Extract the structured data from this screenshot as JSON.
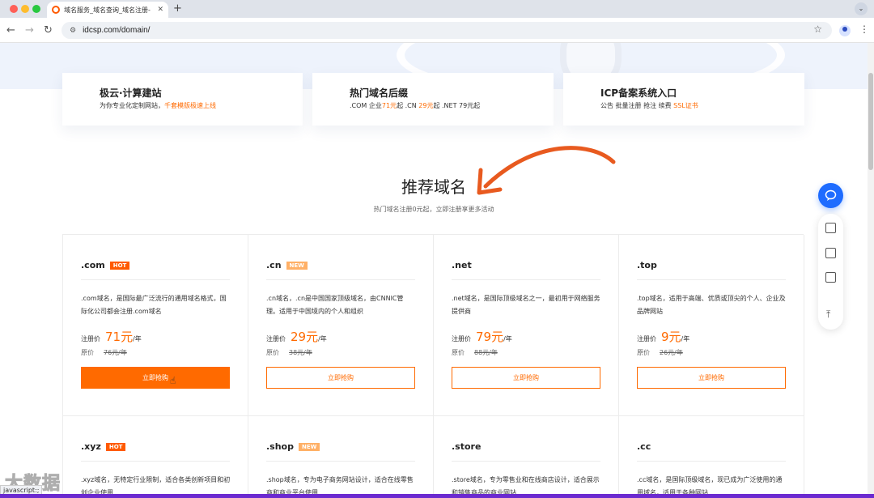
{
  "browser": {
    "tab_title": "域名服务_域名查询_域名注册-",
    "tab_close": "✕",
    "new_tab": "+",
    "url": "idcsp.com/domain/",
    "status_url": "javascript:;"
  },
  "quick_cards": [
    {
      "title": "极云·计算建站",
      "desc_prefix": "为你专业化定制网站，",
      "desc_highlight": "千套模版极速上线",
      "desc_mid": "",
      "desc_highlight2": "",
      "desc_suffix": ""
    },
    {
      "title": "热门域名后缀",
      "desc_prefix": ".COM 企业",
      "desc_highlight": "71元",
      "desc_mid": "起 .CN ",
      "desc_highlight2": "29元",
      "desc_suffix": "起 .NET 79元起"
    },
    {
      "title": "ICP备案系统入口",
      "desc_prefix": "公告 批量注册 抢注 续费 ",
      "desc_highlight": "SSL证书",
      "desc_mid": "",
      "desc_highlight2": "",
      "desc_suffix": ""
    }
  ],
  "section": {
    "title": "推荐域名",
    "subtitle": "热门域名注册0元起，立即注册享更多活动"
  },
  "domains": [
    {
      "name": ".com",
      "badge": "HOT",
      "desc": ".com域名，是国际最广泛流行的通用域名格式，国际化公司都会注册.com域名",
      "price_label": "注册价",
      "price": "71元",
      "unit": "/年",
      "orig_label": "原价",
      "orig": "76元/年",
      "button": "立即抢购"
    },
    {
      "name": ".cn",
      "badge": "NEW",
      "desc": ".cn域名，.cn是中国国家顶级域名，由CNNIC管理。适用于中国境内的个人和组织",
      "price_label": "注册价",
      "price": "29元",
      "unit": "/年",
      "orig_label": "原价",
      "orig": "38元/年",
      "button": "立即抢购"
    },
    {
      "name": ".net",
      "badge": "",
      "desc": ".net域名，是国际顶级域名之一，最初用于网络服务提供商",
      "price_label": "注册价",
      "price": "79元",
      "unit": "/年",
      "orig_label": "原价",
      "orig": "88元/年",
      "button": "立即抢购"
    },
    {
      "name": ".top",
      "badge": "",
      "desc": ".top域名，适用于高端、优质或顶尖的个人、企业及品牌网站",
      "price_label": "注册价",
      "price": "9元",
      "unit": "/年",
      "orig_label": "原价",
      "orig": "26元/年",
      "button": "立即抢购"
    },
    {
      "name": ".xyz",
      "badge": "HOT",
      "desc": ".xyz域名，无特定行业限制，适合各类创新项目和初创企业使用"
    },
    {
      "name": ".shop",
      "badge": "NEW",
      "desc": ".shop域名，专为电子商务网站设计，适合在线零售商和商业平台使用"
    },
    {
      "name": ".store",
      "badge": "",
      "desc": ".store域名，专为零售业和在线商店设计，适合展示和销售商品的商业网站"
    },
    {
      "name": ".cc",
      "badge": "",
      "desc": ".cc域名，是国际顶级域名，现已成为广泛使用的通用域名，适用于各种网站"
    }
  ],
  "watermark": "大数据",
  "colors": {
    "accent": "#ff6a00",
    "chat": "#1e6cff"
  },
  "icons": [
    "favicon-icon",
    "back-icon",
    "forward-icon",
    "reload-icon",
    "site-info-icon",
    "star-icon",
    "profile-icon",
    "menu-icon",
    "chat-icon",
    "video-icon",
    "checklist-icon",
    "search-doc-icon",
    "back-to-top-icon",
    "hand-cursor-icon"
  ]
}
